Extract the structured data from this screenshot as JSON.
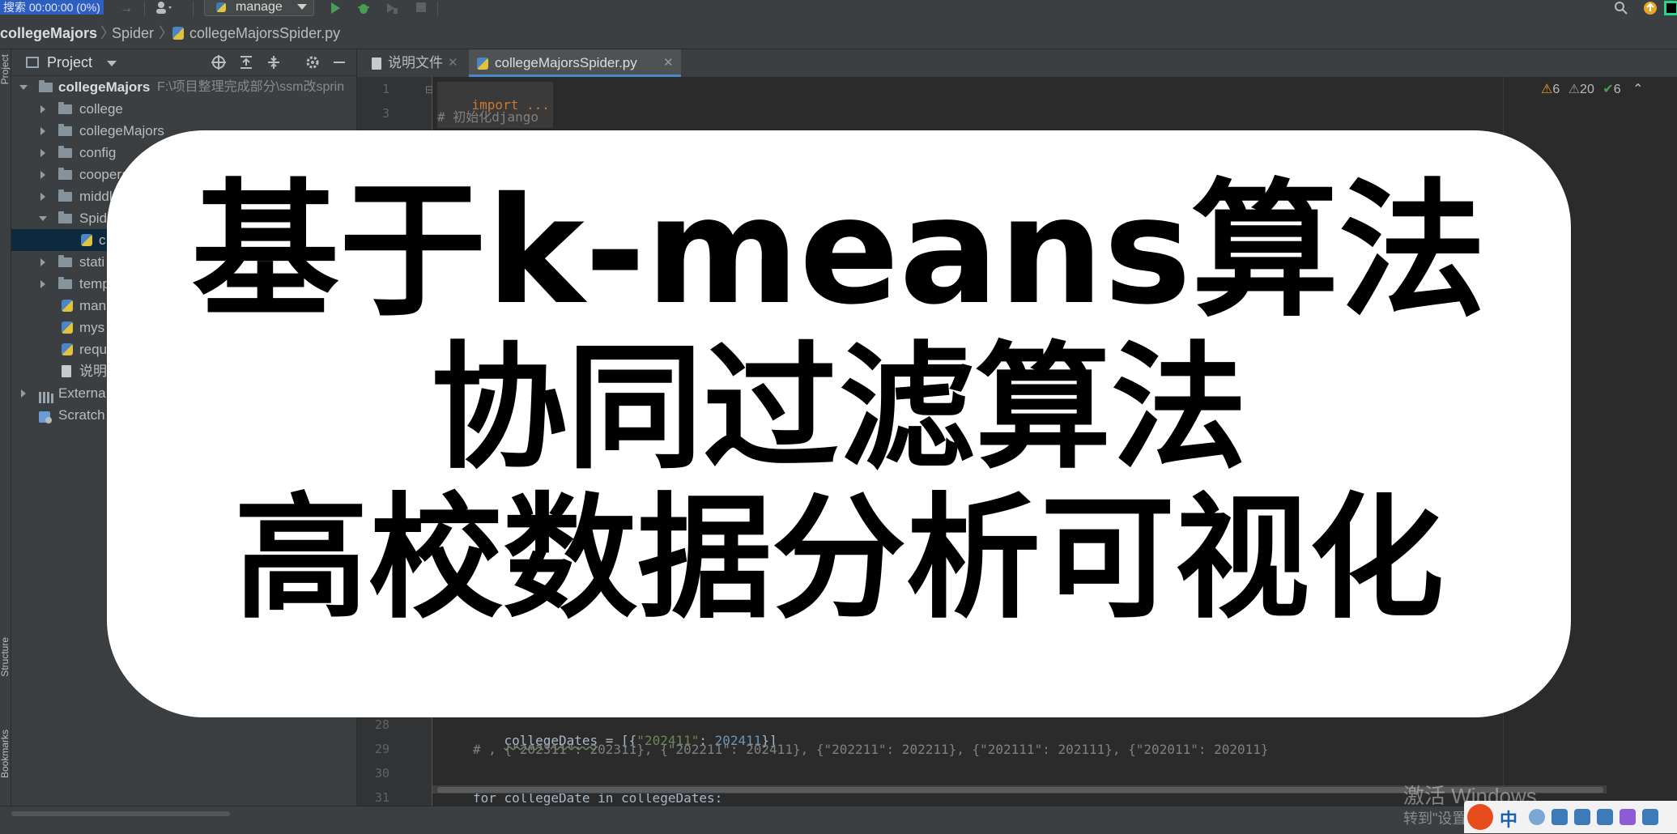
{
  "toolbar": {
    "search_recording": "搜索 00:00:00 (0%)",
    "run_config": "manage"
  },
  "breadcrumb": {
    "items": [
      "collegeMajors",
      "Spider",
      "collegeMajorsSpider.py"
    ]
  },
  "left_stripe": {
    "project_tab": "Project",
    "structure_tab": "Structure",
    "bookmarks_tab": "Bookmarks"
  },
  "project_panel": {
    "title": "Project",
    "root_name": "collegeMajors",
    "root_path": "F:\\项目整理完成部分\\ssm改sprin",
    "items": [
      {
        "label": "college"
      },
      {
        "label": "collegeMajors"
      },
      {
        "label": "config"
      },
      {
        "label": "coopera"
      },
      {
        "label": "middl"
      },
      {
        "label": "Spid"
      },
      {
        "label": "c"
      },
      {
        "label": "stati"
      },
      {
        "label": "temp"
      },
      {
        "label": "man"
      },
      {
        "label": "mys"
      },
      {
        "label": "requ"
      },
      {
        "label": "说明"
      },
      {
        "label": "Externa"
      },
      {
        "label": "Scratch"
      }
    ]
  },
  "editor_tabs": [
    {
      "label": "说明文件"
    },
    {
      "label": "collegeMajorsSpider.py"
    }
  ],
  "inspections": {
    "warnings": "6",
    "weak_warnings": "20",
    "ok": "6"
  },
  "code": {
    "line_numbers": [
      "1",
      "3",
      "28",
      "29",
      "30",
      "31"
    ],
    "line1": "import ...",
    "line3": "# 初始化django",
    "line28_var": "collegeDates",
    "line28_eq": " = [{",
    "line28_str": "\"202411\"",
    "line28_colon": ": ",
    "line28_num": "202411",
    "line28_end": "}]",
    "line29": "# , {\"202311\": 202311}, {\"202211\": 202411}, {\"202211\": 202211}, {\"202111\": 202111}, {\"202011\": 202011}",
    "line31": "for collegeDate in collegeDates:"
  },
  "overlay": {
    "line1": "基于k-means算法",
    "line2": "协同过滤算法",
    "line3": "高校数据分析可视化"
  },
  "watermark": {
    "line1": "激活 Windows",
    "line2": "转到\"设置\"以激活 Windows。"
  },
  "tray": {
    "ime": "中"
  }
}
